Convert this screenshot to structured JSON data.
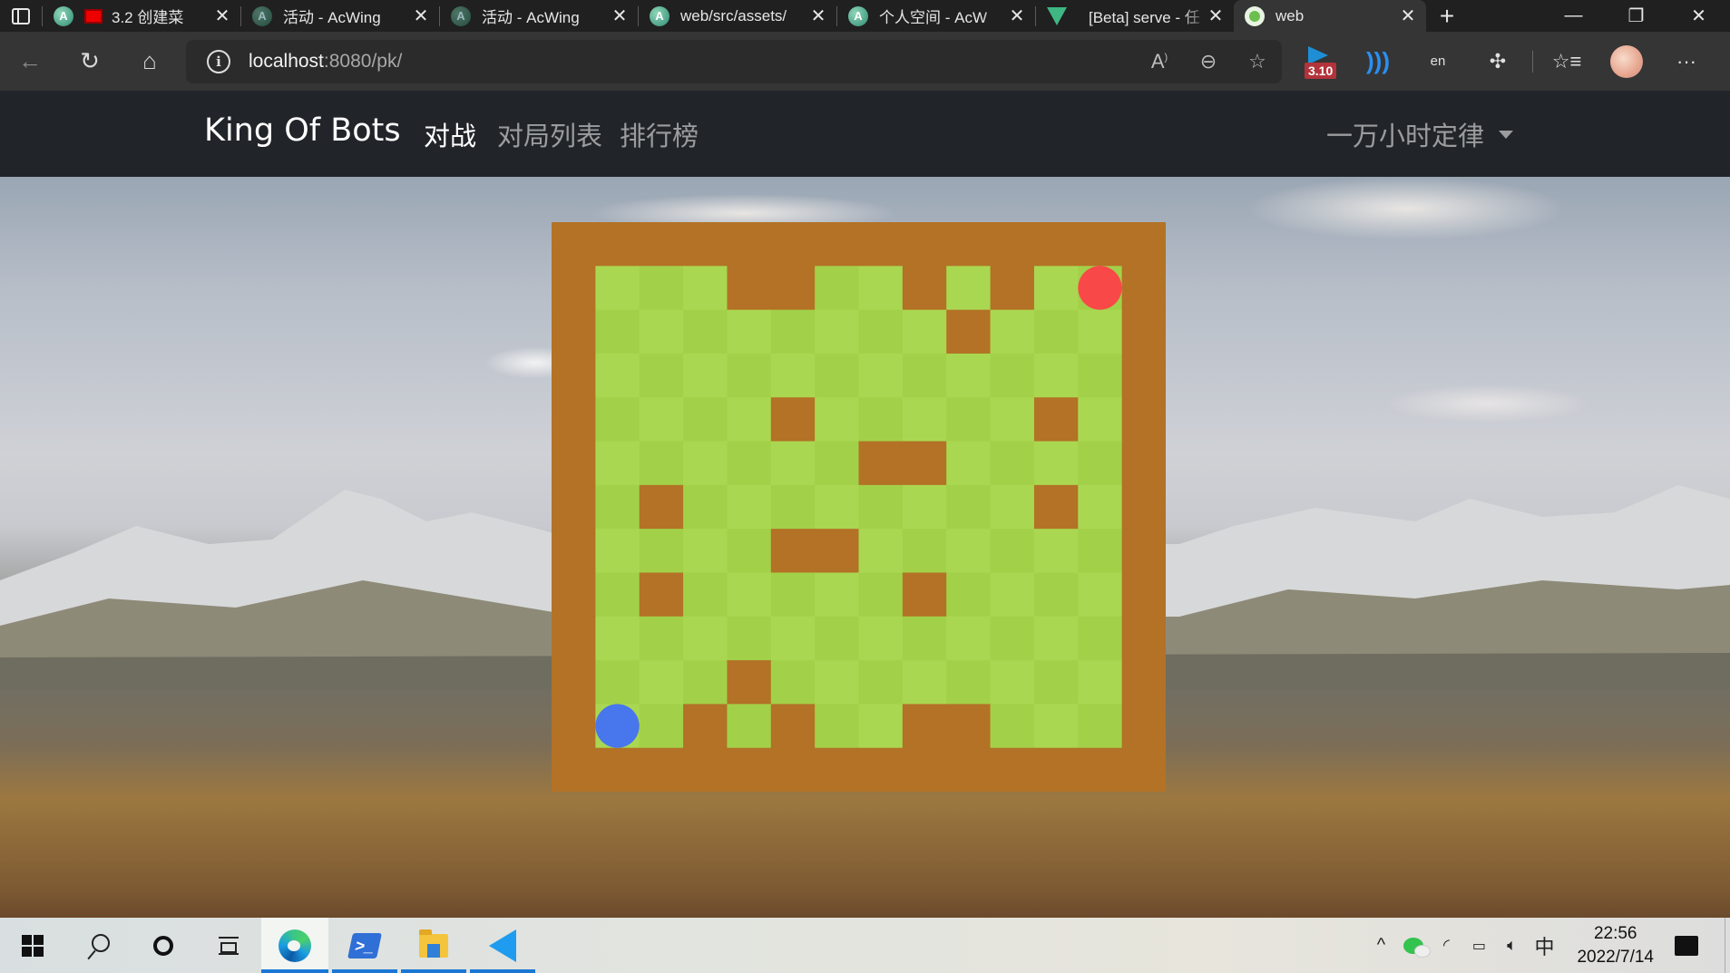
{
  "browser": {
    "tabs": [
      {
        "title": "3.2 创建菜",
        "favicon": "acwing-icon",
        "has_recording_indicator": true,
        "active": false
      },
      {
        "title": "活动 - AcWing",
        "favicon": "acwing-icon",
        "active": false
      },
      {
        "title": "活动 - AcWing",
        "favicon": "acwing-icon",
        "active": false
      },
      {
        "title": "web/src/assets/",
        "favicon": "acwing-icon",
        "active": false
      },
      {
        "title": "个人空间 - AcW",
        "favicon": "acwing-icon",
        "active": false
      },
      {
        "title": "[Beta] serve - 任",
        "favicon": "vue-icon",
        "active": false
      },
      {
        "title": "web",
        "favicon": "web-app-icon",
        "active": true
      }
    ],
    "close_glyph": "✕",
    "new_tab_glyph": "+",
    "window_controls": {
      "minimize": "—",
      "restore": "❐",
      "close": "✕"
    },
    "address": {
      "host": "localhost",
      "rest": ":8080/pk/"
    },
    "toolbar_icons": [
      "back-icon",
      "refresh-icon",
      "home-icon"
    ],
    "omnibox_icons": [
      "read-aloud-icon",
      "zoom-out-icon",
      "add-favorite-icon"
    ],
    "extensions": {
      "badge_text": "3.10",
      "translate_glyph": "en"
    },
    "more_glyph": "···"
  },
  "navbar": {
    "brand": "King Of Bots",
    "links": [
      {
        "label": "对战",
        "active": true
      },
      {
        "label": "对局列表",
        "active": false
      },
      {
        "label": "排行榜",
        "active": false
      }
    ],
    "user": {
      "name": "一万小时定律"
    }
  },
  "game": {
    "rows": 13,
    "cols": 14,
    "colors": {
      "wall": "#B37226",
      "grass_light": "#AAD751",
      "grass_dark": "#A2D149",
      "snake_a": "#4876EC",
      "snake_b": "#F94848"
    },
    "inner_walls": [
      [
        1,
        4
      ],
      [
        1,
        5
      ],
      [
        1,
        8
      ],
      [
        1,
        10
      ],
      [
        2,
        9
      ],
      [
        4,
        5
      ],
      [
        4,
        11
      ],
      [
        5,
        7
      ],
      [
        5,
        8
      ],
      [
        6,
        2
      ],
      [
        6,
        11
      ],
      [
        7,
        5
      ],
      [
        7,
        6
      ],
      [
        8,
        2
      ],
      [
        8,
        8
      ],
      [
        10,
        4
      ],
      [
        11,
        3
      ],
      [
        11,
        5
      ],
      [
        11,
        8
      ],
      [
        11,
        9
      ]
    ],
    "snakes": [
      {
        "name": "blue",
        "row": 11,
        "col": 1
      },
      {
        "name": "red",
        "row": 1,
        "col": 12
      }
    ]
  },
  "taskbar": {
    "apps": [
      {
        "name": "edge",
        "running": true,
        "focused": true
      },
      {
        "name": "powershell",
        "running": true
      },
      {
        "name": "file-explorer",
        "running": true
      },
      {
        "name": "vscode",
        "running": true
      }
    ],
    "tray": {
      "chevron": "^",
      "ime": "中",
      "time": "22:56",
      "date": "2022/7/14"
    }
  }
}
